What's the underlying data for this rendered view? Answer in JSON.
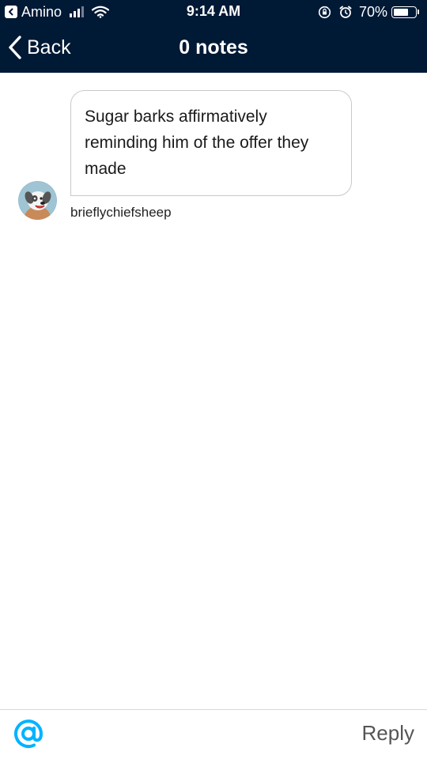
{
  "status_bar": {
    "back_app_label": "Amino",
    "time": "9:14 AM",
    "battery_percent_text": "70%",
    "battery_level": 0.7,
    "icons": [
      "back-arrow-icon",
      "signal-icon",
      "wifi-icon",
      "rotation-lock-icon",
      "alarm-icon",
      "battery-icon"
    ]
  },
  "nav": {
    "back_label": "Back",
    "title": "0 notes"
  },
  "message": {
    "text": "Sugar barks affirmatively reminding him of the offer they made",
    "username": "brieflychiefsheep",
    "avatar_icon": "dog-avatar"
  },
  "bottom_bar": {
    "mention_icon": "at-sign-icon",
    "reply_label": "Reply"
  },
  "colors": {
    "header_bg": "#001935",
    "accent": "#00b3ff",
    "bubble_border": "#c9c9c9",
    "reply_text": "#555555"
  }
}
